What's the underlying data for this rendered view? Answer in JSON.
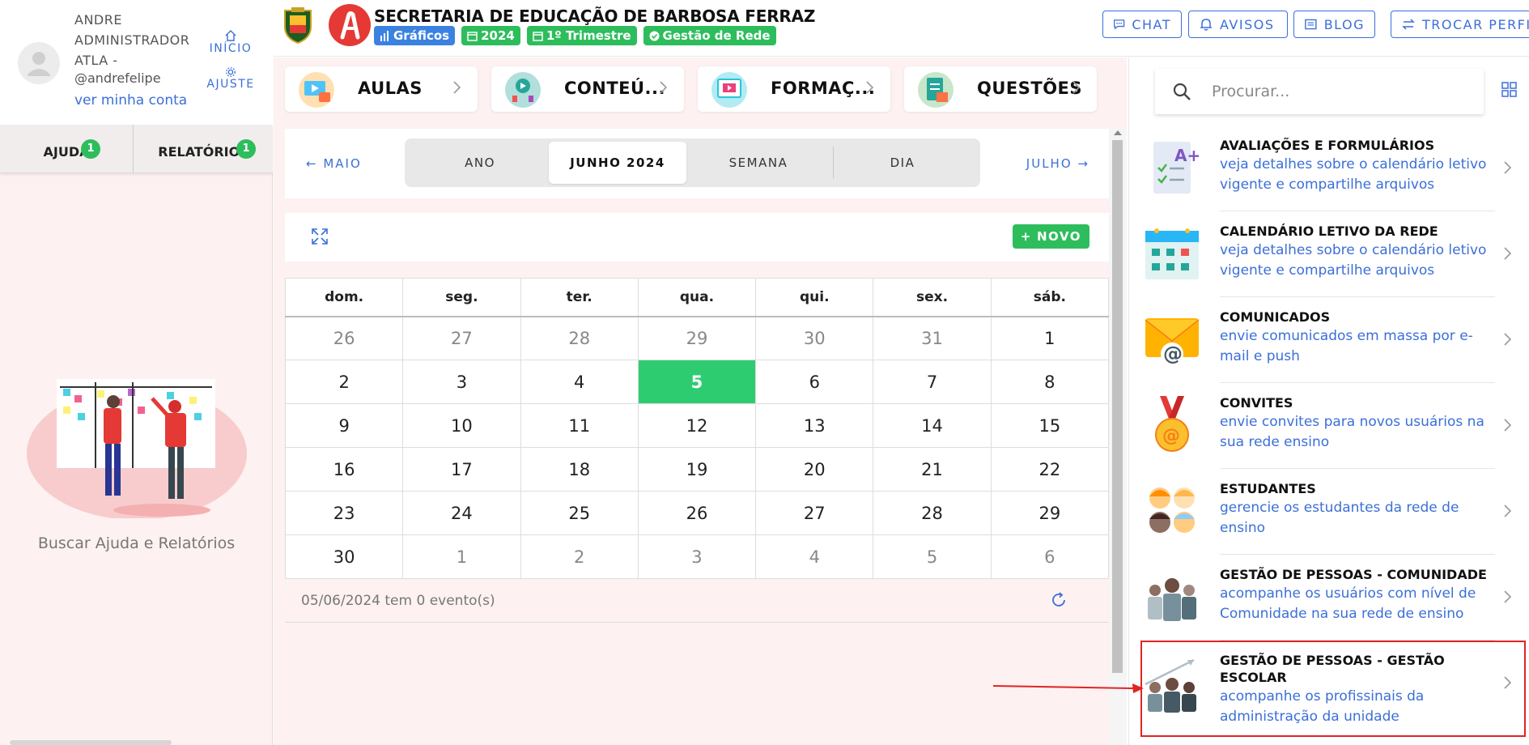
{
  "user": {
    "name": "ANDRE ADMINISTRADOR ATLA -",
    "handle": "@andrefelipe",
    "account_link": "ver minha conta"
  },
  "sidebar": {
    "nav": [
      {
        "label": "INÍCIO",
        "icon": "home-icon"
      },
      {
        "label": "AJUSTE",
        "icon": "gear-icon"
      }
    ],
    "tabs": [
      {
        "label": "AJUDA",
        "badge": "1"
      },
      {
        "label": "RELATÓRIOS",
        "badge": "1"
      }
    ],
    "help_caption": "Buscar Ajuda e Relatórios"
  },
  "header": {
    "title": "SECRETARIA DE EDUCAÇÃO DE BARBOSA FERRAZ",
    "chips": [
      {
        "label": "Gráficos",
        "icon": "chart-icon",
        "color": "#3b82e0"
      },
      {
        "label": "2024",
        "icon": "calendar-icon",
        "color": "#2ebd5c"
      },
      {
        "label": "1º Trimestre",
        "icon": "calendar-icon",
        "color": "#2ebd5c"
      },
      {
        "label": "Gestão de Rede",
        "icon": "check-circle-icon",
        "color": "#2ebd5c"
      }
    ],
    "buttons": [
      {
        "label": "CHAT",
        "icon": "chat-icon"
      },
      {
        "label": "AVISOS",
        "icon": "bell-icon"
      },
      {
        "label": "BLOG",
        "icon": "newspaper-icon"
      },
      {
        "label": "TROCAR PERFI",
        "icon": "swap-icon"
      }
    ]
  },
  "categories": [
    {
      "label": "AULAS"
    },
    {
      "label": "CONTEÚ..."
    },
    {
      "label": "FORMAÇ..."
    },
    {
      "label": "QUESTÕES"
    }
  ],
  "calendar": {
    "prev_month": "MAIO",
    "next_month": "JULHO",
    "views": [
      "ANO",
      "JUNHO 2024",
      "SEMANA",
      "DIA"
    ],
    "active_view": "JUNHO 2024",
    "new_button": "NOVO",
    "weekdays": [
      "dom.",
      "seg.",
      "ter.",
      "qua.",
      "qui.",
      "sex.",
      "sáb."
    ],
    "weeks": [
      [
        "26",
        "27",
        "28",
        "29",
        "30",
        "31",
        "1"
      ],
      [
        "2",
        "3",
        "4",
        "5",
        "6",
        "7",
        "8"
      ],
      [
        "9",
        "10",
        "11",
        "12",
        "13",
        "14",
        "15"
      ],
      [
        "16",
        "17",
        "18",
        "19",
        "20",
        "21",
        "22"
      ],
      [
        "23",
        "24",
        "25",
        "26",
        "27",
        "28",
        "29"
      ],
      [
        "30",
        "1",
        "2",
        "3",
        "4",
        "5",
        "6"
      ]
    ],
    "today": "5",
    "events_text": "05/06/2024 tem 0 evento(s)",
    "today_color": "#2ecc71"
  },
  "right_panel": {
    "search_placeholder": "Procurar...",
    "modules": [
      {
        "title": "AVALIAÇÕES E FORMULÁRIOS",
        "desc": "veja detalhes sobre o calendário letivo vigente e compartilhe arquivos",
        "icon": "form-checklist-icon"
      },
      {
        "title": "CALENDÁRIO LETIVO DA REDE",
        "desc": "veja detalhes sobre o calendário letivo vigente e compartilhe arquivos",
        "icon": "calendar-grid-icon"
      },
      {
        "title": "COMUNICADOS",
        "desc": "envie comunicados em massa por e-mail e push",
        "icon": "envelope-at-icon"
      },
      {
        "title": "CONVITES",
        "desc": "envie convites para novos usuários na sua rede ensino",
        "icon": "medal-icon"
      },
      {
        "title": "ESTUDANTES",
        "desc": "gerencie os estudantes da rede de ensino",
        "icon": "students-icon"
      },
      {
        "title": "GESTÃO DE PESSOAS - COMUNIDADE",
        "desc": "acompanhe os usuários com nível de Comunidade na sua rede de ensino",
        "icon": "community-people-icon"
      },
      {
        "title": "GESTÃO DE PESSOAS - GESTÃO ESCOLAR",
        "desc": "acompanhe os profissinais da administração da unidade",
        "icon": "school-management-icon"
      }
    ],
    "highlight_color": "#e02424"
  }
}
